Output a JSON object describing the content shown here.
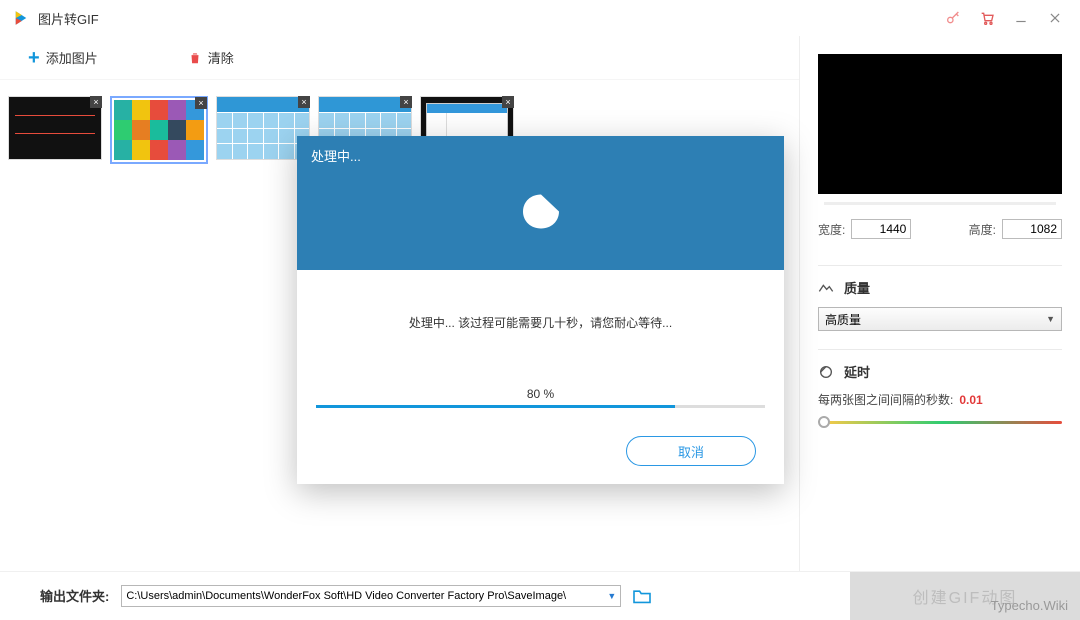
{
  "app": {
    "title": "图片转GIF"
  },
  "toolbar": {
    "add_label": "添加图片",
    "clear_label": "清除"
  },
  "thumbnails": [
    {
      "style": "dark"
    },
    {
      "style": "colors",
      "selected": true
    },
    {
      "style": "grid"
    },
    {
      "style": "grid"
    },
    {
      "style": "window"
    }
  ],
  "panel": {
    "width_label": "宽度:",
    "width_value": "1440",
    "height_label": "高度:",
    "height_value": "1082",
    "quality_heading": "质量",
    "quality_value": "高质量",
    "delay_heading": "延时",
    "delay_label": "每两张图之间间隔的秒数:",
    "delay_value": "0.01"
  },
  "modal": {
    "title": "处理中...",
    "message": "处理中... 该过程可能需要几十秒，请您耐心等待...",
    "percent_text": "80 %",
    "percent_num": 80,
    "cancel": "取消"
  },
  "bottom": {
    "label": "输出文件夹:",
    "path": "C:\\Users\\admin\\Documents\\WonderFox Soft\\HD Video Converter Factory Pro\\SaveImage\\",
    "create_label": "创建GIF动图"
  },
  "watermark": "Typecho.Wiki"
}
